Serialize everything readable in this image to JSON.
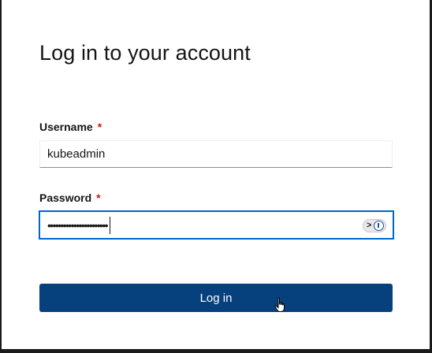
{
  "login": {
    "title": "Log in to your account",
    "username_label": "Username",
    "username_required": "*",
    "username_value": "kubeadmin",
    "password_label": "Password",
    "password_required": "*",
    "password_masked": "•••••••••••••••••••••••",
    "submit_label": "Log in"
  },
  "icons": {
    "password_manager": "password-manager-icon",
    "cursor": "hand-pointer-icon"
  },
  "colors": {
    "primary_button": "#06407d",
    "focus_border": "#0066cc",
    "required": "#c9190b"
  }
}
